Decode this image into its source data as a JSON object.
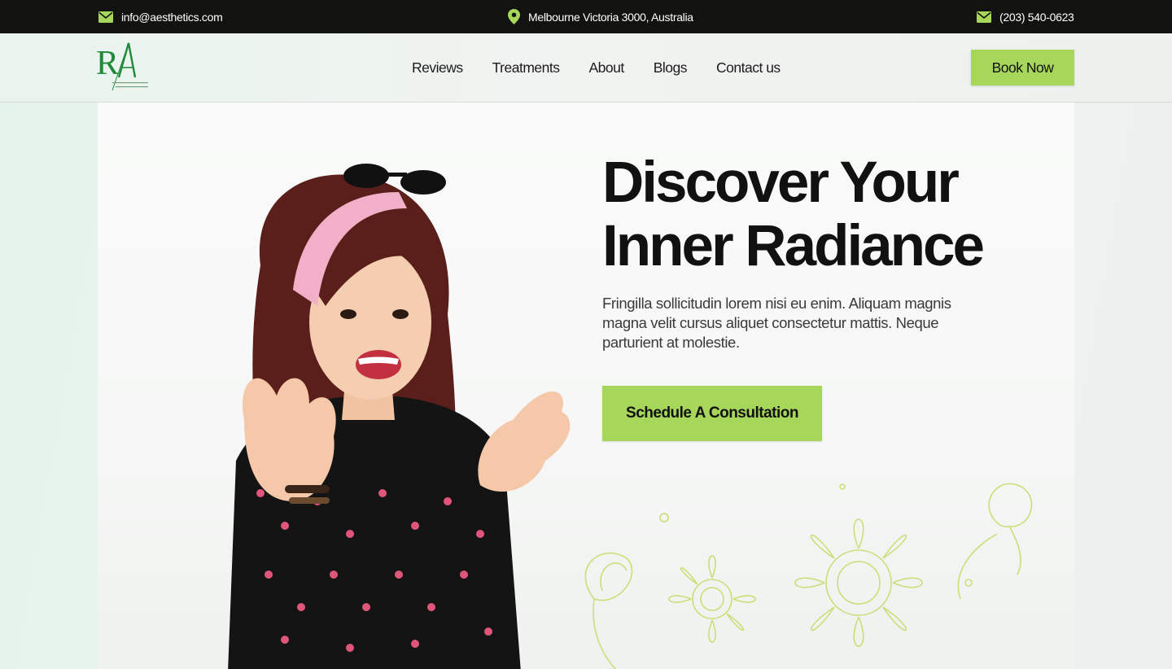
{
  "topbar": {
    "email": "info@aesthetics.com",
    "address": "Melbourne Victoria 3000, Australia",
    "phone": "(203) 540-0623",
    "email_icon": "mail-icon",
    "location_icon": "map-pin-icon",
    "phone_icon": "mail-icon"
  },
  "header": {
    "nav": [
      "Reviews",
      "Treatments",
      "About",
      "Blogs",
      "Contact us"
    ],
    "book_label": "Book Now",
    "logo_letters": "RA"
  },
  "hero": {
    "title_line1": "Discover Your",
    "title_line2": "Inner Radiance",
    "description": "Fringilla sollicitudin lorem nisi eu enim. Aliquam  magnis magna velit cursus aliquet consectetur mattis. Neque parturient at molestie.",
    "cta_label": "Schedule A Consultation"
  },
  "colors": {
    "accent": "#a6d65a",
    "topbar_bg": "#121311",
    "logo_green": "#1f8a3a"
  }
}
